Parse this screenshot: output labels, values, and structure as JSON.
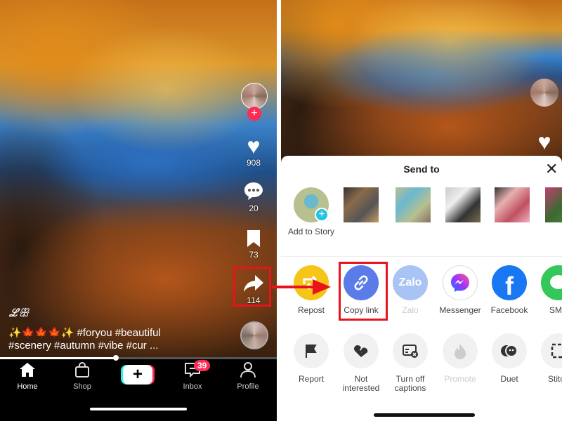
{
  "left": {
    "rail": {
      "likes": "908",
      "comments": "20",
      "saves": "73",
      "shares": "114"
    },
    "author_mark": "ℒꕥ",
    "caption_line1": "✨🍁🍁🍁✨ #foryou #beautiful",
    "caption_line2": "#scenery #autumn #vibe #cur  ...",
    "progress": 0.42,
    "nav": {
      "home": "Home",
      "shop": "Shop",
      "inbox": "Inbox",
      "inbox_badge": "39",
      "profile": "Profile"
    }
  },
  "right": {
    "sheet_title": "Send to",
    "add_to_story": "Add to Story",
    "share_options": [
      {
        "label": "Repost",
        "color": "#f5c518"
      },
      {
        "label": "Copy link",
        "color": "#5b7be8"
      },
      {
        "label": "Zalo",
        "color": "#a9c3f5"
      },
      {
        "label": "Messenger",
        "color": "#ffffff"
      },
      {
        "label": "Facebook",
        "color": "#1877f2"
      },
      {
        "label": "SMS",
        "color": "#34c759"
      }
    ],
    "actions": [
      {
        "label": "Report",
        "icon": "flag-icon"
      },
      {
        "label": "Not\ninterested",
        "icon": "broken-heart-icon"
      },
      {
        "label": "Turn off\ncaptions",
        "icon": "captions-off-icon"
      },
      {
        "label": "Promote",
        "icon": "flame-icon"
      },
      {
        "label": "Duet",
        "icon": "duet-icon"
      },
      {
        "label": "Stitch",
        "icon": "stitch-icon"
      }
    ]
  },
  "colors": {
    "highlight": "#e8131b",
    "tiktok_red": "#fe2c55",
    "tiktok_cyan": "#25f4ee"
  }
}
